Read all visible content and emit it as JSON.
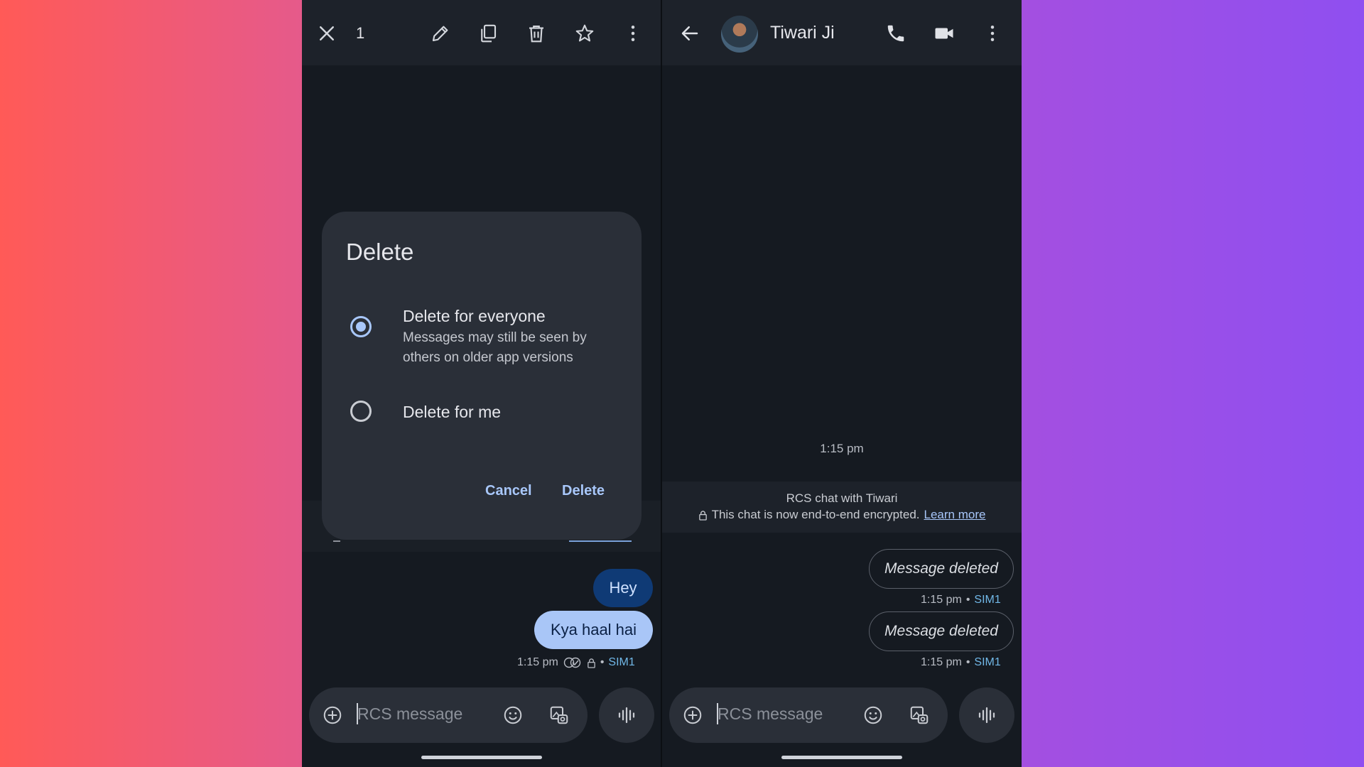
{
  "colors": {
    "accent": "#a8c7fa",
    "bubble_dark": "#0f3a75",
    "bubble_light": "#a9c6f7",
    "sim": "#71b8e8"
  },
  "left": {
    "topbar": {
      "selected_count": "1",
      "icons": [
        "close-icon",
        "edit-icon",
        "copy-icon",
        "delete-icon",
        "star-icon",
        "more-vert-icon"
      ]
    },
    "dialog": {
      "title": "Delete",
      "options": [
        {
          "title": "Delete for everyone",
          "subtitle": "Messages may still be seen by others on older app versions",
          "selected": true
        },
        {
          "title": "Delete for me",
          "selected": false
        }
      ],
      "cancel_label": "Cancel",
      "delete_label": "Delete"
    },
    "messages": [
      {
        "text": "Hey"
      },
      {
        "text": "Kya haal hai"
      }
    ],
    "meta": {
      "time": "1:15 pm",
      "sep": "•",
      "sim": "SIM1"
    },
    "composer": {
      "placeholder": "RCS message"
    }
  },
  "right": {
    "header": {
      "contact_name": "Tiwari Ji"
    },
    "time_label": "1:15 pm",
    "banner": {
      "line1": "RCS chat with Tiwari",
      "line2": "This chat is now end-to-end encrypted.",
      "learn_more": "Learn more"
    },
    "messages": [
      {
        "text": "Message deleted",
        "time": "1:15 pm",
        "sep": "•",
        "sim": "SIM1"
      },
      {
        "text": "Message deleted",
        "time": "1:15 pm",
        "sep": "•",
        "sim": "SIM1"
      }
    ],
    "composer": {
      "placeholder": "RCS message"
    }
  }
}
